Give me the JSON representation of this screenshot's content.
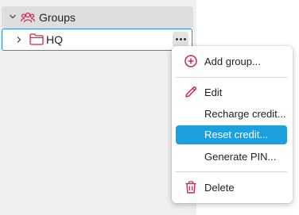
{
  "tree": {
    "groups_label": "Groups",
    "hq_label": "HQ"
  },
  "menu": {
    "items": [
      {
        "label": "Add group...",
        "icon": "plus-circle-icon"
      },
      {
        "label": "Edit",
        "icon": "pencil-icon"
      },
      {
        "label": "Recharge credit...",
        "icon": ""
      },
      {
        "label": "Reset credit...",
        "icon": "",
        "selected": true
      },
      {
        "label": "Generate PIN...",
        "icon": ""
      },
      {
        "label": "Delete",
        "icon": "trash-icon"
      }
    ]
  },
  "colors": {
    "accent_red": "#d6234a",
    "selection_blue": "#1e9fde",
    "focus_border": "#2b8fd6"
  }
}
